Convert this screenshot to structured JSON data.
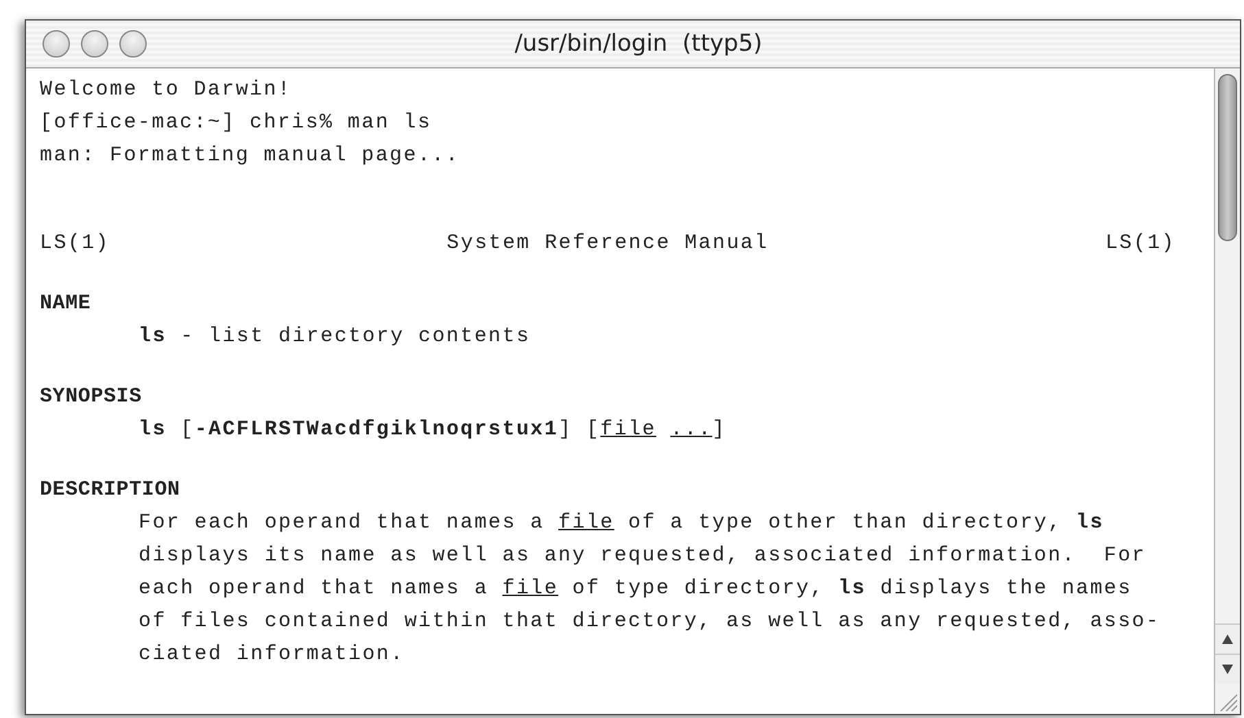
{
  "window": {
    "title": "/usr/bin/login  (ttyp5)",
    "active": false
  },
  "terminal": {
    "lines": [
      {
        "kind": "text",
        "text": "Welcome to Darwin!"
      },
      {
        "kind": "text",
        "text": "[office-mac:~] chris% man ls"
      },
      {
        "kind": "text",
        "text": "man: Formatting manual page..."
      },
      {
        "kind": "blank"
      },
      {
        "kind": "blank"
      },
      {
        "kind": "header",
        "left": "LS(1)",
        "center": "System Reference Manual",
        "right": "LS(1)"
      },
      {
        "kind": "blank"
      },
      {
        "kind": "section",
        "text": "NAME"
      },
      {
        "kind": "body",
        "text": "**ls** - list directory contents"
      },
      {
        "kind": "blank"
      },
      {
        "kind": "section",
        "text": "SYNOPSIS"
      },
      {
        "kind": "body",
        "text": "**ls** [**-ACFLRSTWacdfgiklnoqrstux1**] [*file* *...*]"
      },
      {
        "kind": "blank"
      },
      {
        "kind": "section",
        "text": "DESCRIPTION"
      },
      {
        "kind": "body",
        "text": "For each operand that names a *file* of a type other than directory, **ls**"
      },
      {
        "kind": "body",
        "text": "displays its name as well as any requested, associated information.  For"
      },
      {
        "kind": "body",
        "text": "each operand that names a *file* of type directory, **ls** displays the names"
      },
      {
        "kind": "body",
        "text": "of files contained within that directory, as well as any requested, asso-"
      },
      {
        "kind": "body",
        "text": "ciated information."
      }
    ]
  }
}
